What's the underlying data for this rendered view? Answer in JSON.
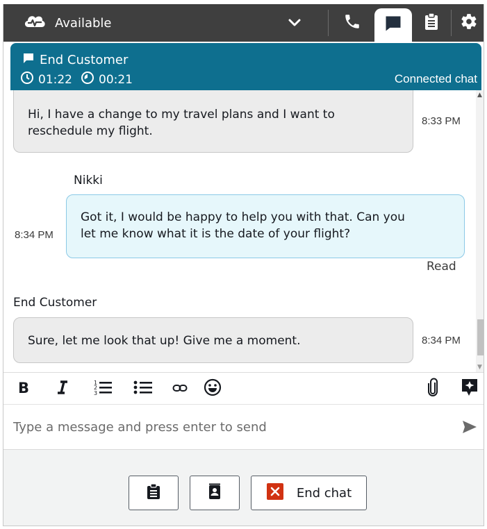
{
  "topbar": {
    "status_label": "Available",
    "icons": [
      "cloud-heartbeat-icon",
      "chevron-down-icon",
      "phone-icon",
      "chat-icon",
      "clipboard-icon",
      "gear-icon"
    ]
  },
  "contact": {
    "name": "End Customer",
    "timer_total": "01:22",
    "timer_state": "00:21",
    "state": "Connected chat"
  },
  "transcript": {
    "messages": [
      {
        "sender": "",
        "text_line1": "Hi, I have a change to my travel plans and I want to",
        "text_line2": "reschedule my flight.",
        "time": "8:33 PM"
      },
      {
        "sender": "Nikki",
        "text_line1": "Got it, I would be happy to help you with that. Can you",
        "text_line2": "let me know what it is the date of your flight?",
        "time": "8:34 PM",
        "receipt": "Read"
      },
      {
        "sender": "End Customer",
        "text_line1": "Sure, let me look that up! Give me a moment.",
        "time": "8:34 PM"
      }
    ]
  },
  "toolbar": {
    "icons": [
      "bold-icon",
      "italic-icon",
      "numbered-list-icon",
      "bullet-list-icon",
      "link-icon",
      "emoji-icon",
      "attachment-icon",
      "quick-responses-icon"
    ]
  },
  "compose": {
    "placeholder": "Type a message and press enter to send",
    "value": ""
  },
  "footer": {
    "end_chat_label": "End chat",
    "end_icon_color": "#d13212"
  },
  "colors": {
    "topbar": "#3f3f3f",
    "contact_header": "#0e6f8f",
    "agent_bubble": "#e6f7fb",
    "customer_bubble": "#ececec"
  }
}
